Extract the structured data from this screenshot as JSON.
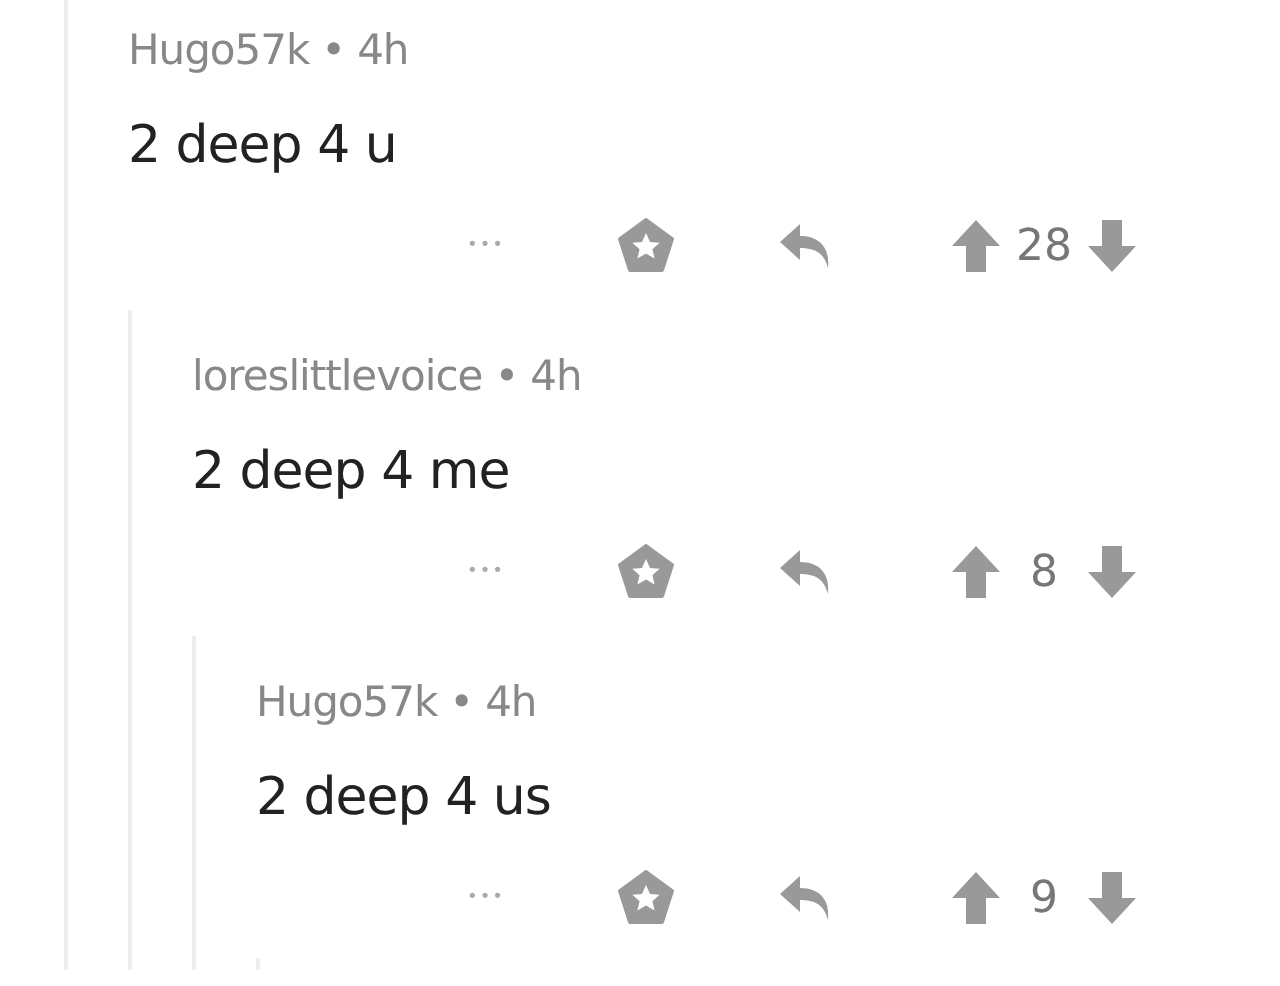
{
  "comments": [
    {
      "author": "Hugo57k",
      "separator": "•",
      "age": "4h",
      "body": "2 deep 4 u",
      "more_label": "•••",
      "score": "28",
      "children": [
        {
          "author": "loreslittlevoice",
          "separator": "•",
          "age": "4h",
          "body": "2 deep 4 me",
          "more_label": "•••",
          "score": "8",
          "children": [
            {
              "author": "Hugo57k",
              "separator": "•",
              "age": "4h",
              "body": "2 deep 4 us",
              "more_label": "•••",
              "score": "9",
              "more_replies": true
            }
          ]
        }
      ]
    }
  ]
}
